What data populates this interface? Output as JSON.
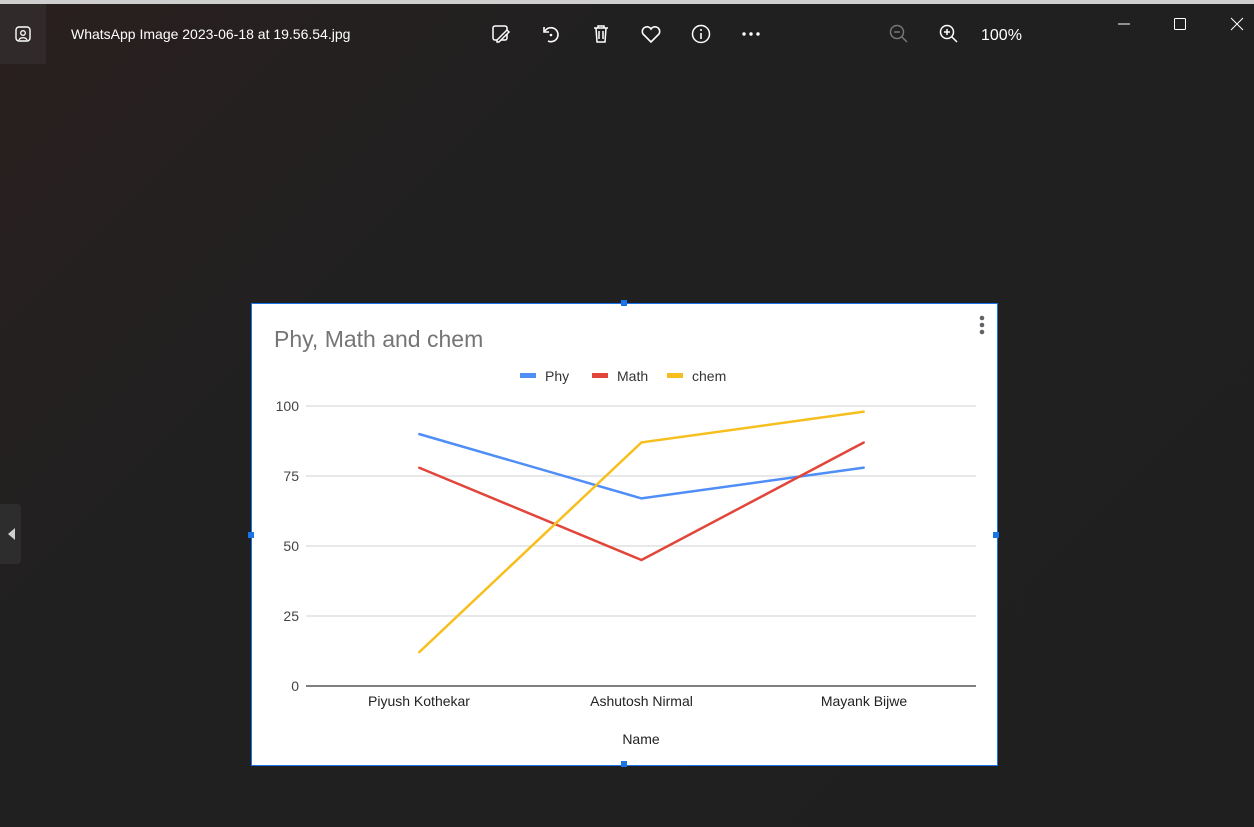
{
  "window": {
    "filename": "WhatsApp Image 2023-06-18 at 19.56.54.jpg",
    "zoom_level": "100%",
    "toolbar_icons": [
      "edit-image-icon",
      "rotate-icon",
      "delete-icon",
      "favorite-icon",
      "info-icon",
      "more-icon"
    ],
    "zoom_icons": [
      "zoom-out-icon",
      "zoom-in-icon"
    ],
    "window_controls": [
      "minimize-icon",
      "maximize-icon",
      "close-icon"
    ]
  },
  "chart_data": {
    "type": "line",
    "title": "Phy, Math and chem",
    "xlabel": "Name",
    "ylabel": "",
    "categories": [
      "Piyush Kothekar",
      "Ashutosh Nirmal",
      "Mayank Bijwe"
    ],
    "ylim": [
      0,
      100
    ],
    "yticks": [
      "0",
      "25",
      "50",
      "75",
      "100"
    ],
    "grid": true,
    "legend_position": "top",
    "series": [
      {
        "name": "Phy",
        "color": "#4f8ef7",
        "values": [
          90,
          67,
          78
        ]
      },
      {
        "name": "Math",
        "color": "#e2463b",
        "values": [
          78,
          45,
          87
        ]
      },
      {
        "name": "chem",
        "color": "#f6bf1d",
        "values": [
          12,
          87,
          98
        ]
      }
    ]
  }
}
